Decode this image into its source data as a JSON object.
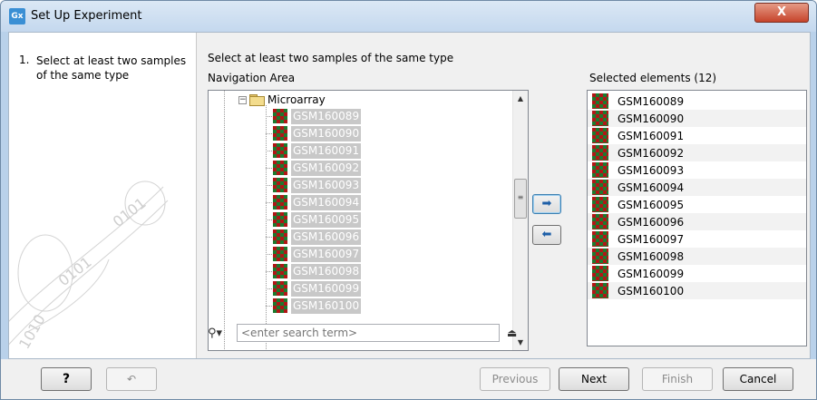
{
  "window": {
    "title": "Set Up Experiment",
    "app_icon": "Gx",
    "close_label": "X"
  },
  "steps": [
    {
      "number": "1.",
      "label": "Select at least two samples of the same type"
    }
  ],
  "main": {
    "heading": "Select at least two samples of the same type",
    "navigation_label": "Navigation Area",
    "selected_label": "Selected elements (12)"
  },
  "tree": {
    "folder": "Microarray",
    "items": [
      "GSM160089",
      "GSM160090",
      "GSM160091",
      "GSM160092",
      "GSM160093",
      "GSM160094",
      "GSM160095",
      "GSM160096",
      "GSM160097",
      "GSM160098",
      "GSM160099",
      "GSM160100"
    ]
  },
  "search": {
    "placeholder": "<enter search term>"
  },
  "selected": {
    "items": [
      "GSM160089",
      "GSM160090",
      "GSM160091",
      "GSM160092",
      "GSM160093",
      "GSM160094",
      "GSM160095",
      "GSM160096",
      "GSM160097",
      "GSM160098",
      "GSM160099",
      "GSM160100"
    ]
  },
  "buttons": {
    "help": "?",
    "previous": "Previous",
    "next": "Next",
    "finish": "Finish",
    "cancel": "Cancel",
    "move_right_icon": "arrow-right-icon",
    "move_left_icon": "arrow-left-icon"
  }
}
